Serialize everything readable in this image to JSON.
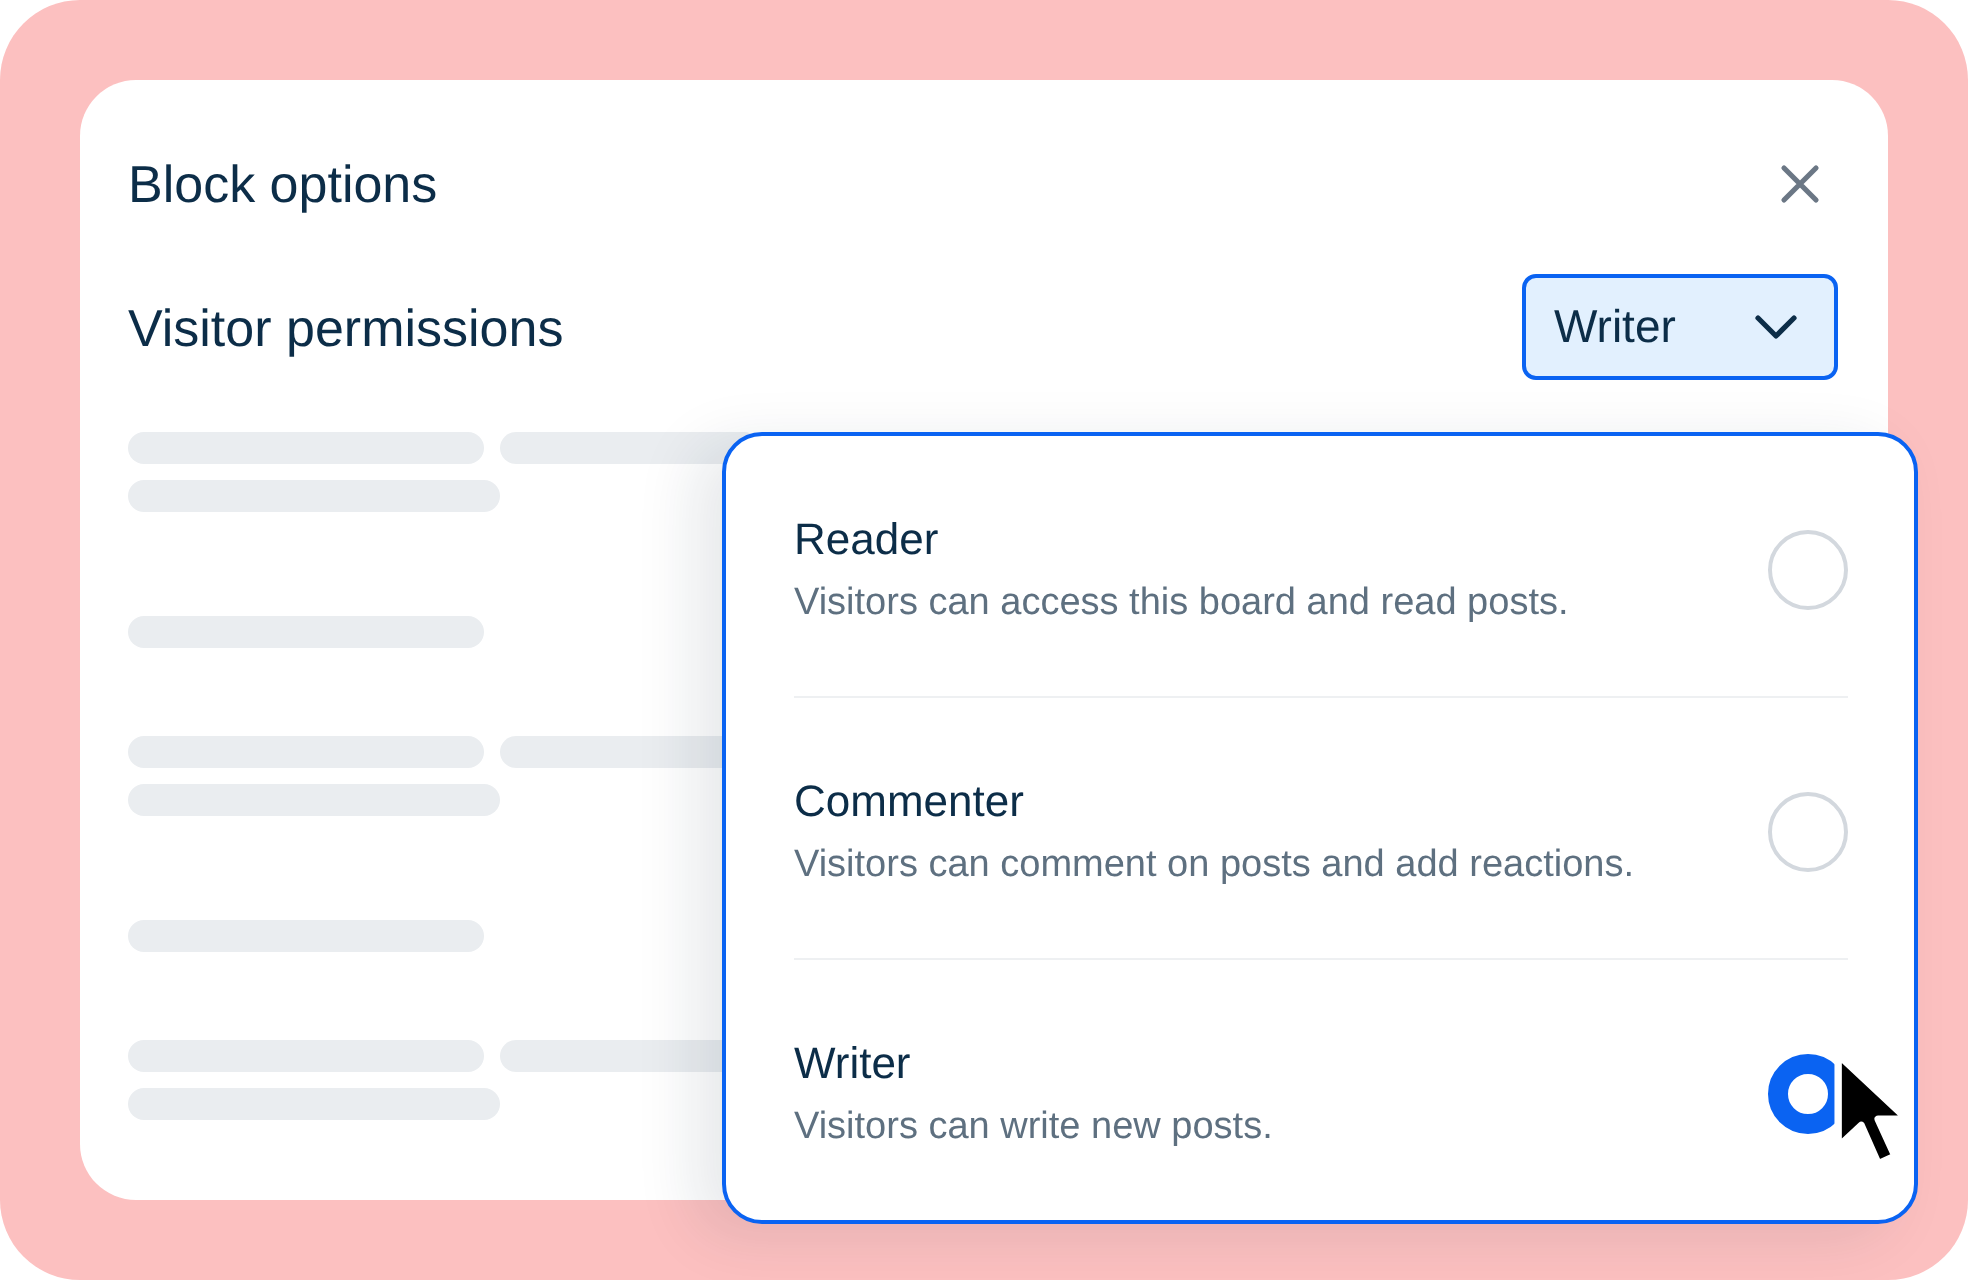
{
  "dialog": {
    "title": "Block options"
  },
  "permissions": {
    "label": "Visitor permissions",
    "dropdown": {
      "value": "Writer",
      "expanded": true
    }
  },
  "options": [
    {
      "title": "Reader",
      "description": "Visitors can access this board and read posts.",
      "selected": false
    },
    {
      "title": "Commenter",
      "description": "Visitors can comment on posts and add reactions.",
      "selected": false
    },
    {
      "title": "Writer",
      "description": "Visitors can write new posts.",
      "selected": true
    }
  ]
}
